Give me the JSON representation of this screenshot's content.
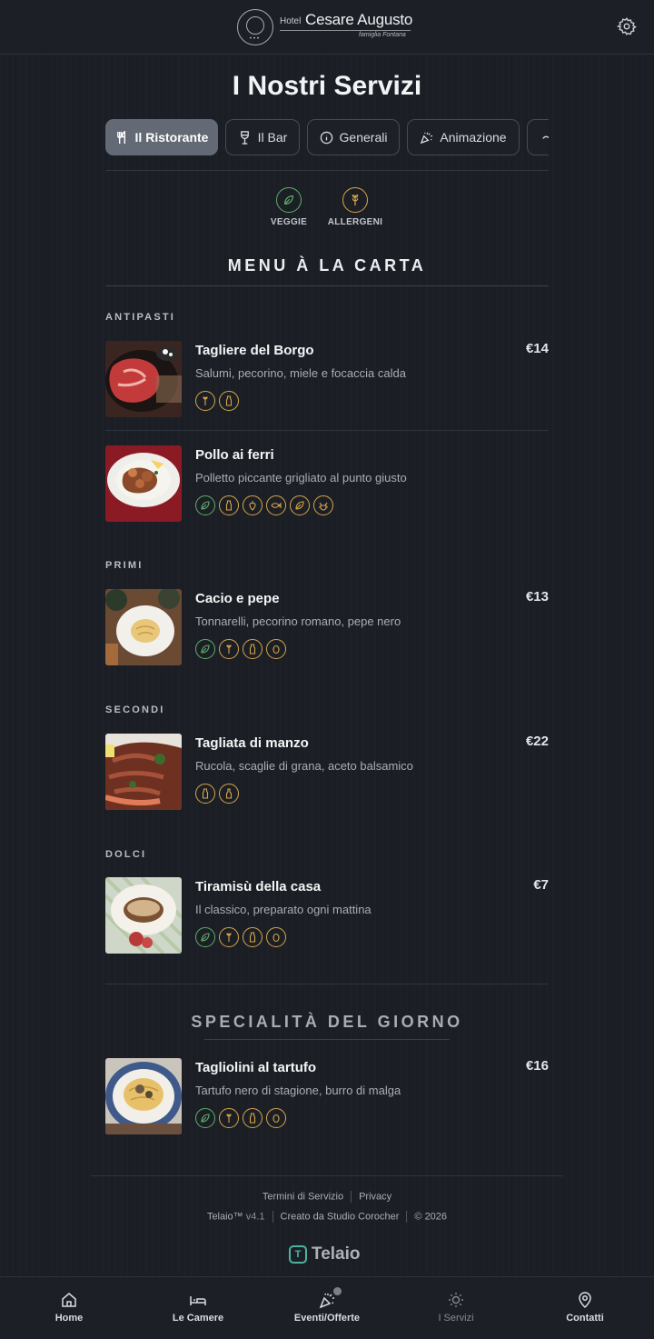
{
  "header": {
    "logo_hotel": "Hotel",
    "logo_name": "Cesare Augusto",
    "logo_family": "famiglia Fontana",
    "logo_stars": "•••"
  },
  "page": {
    "title": "I Nostri Servizi"
  },
  "tabs": [
    {
      "label": "Il Ristorante",
      "icon": "utensils-icon",
      "active": true
    },
    {
      "label": "Il Bar",
      "icon": "wine-glass-icon",
      "active": false
    },
    {
      "label": "Generali",
      "icon": "info-icon",
      "active": false
    },
    {
      "label": "Animazione",
      "icon": "party-icon",
      "active": false
    },
    {
      "label": "",
      "icon": "more-icon",
      "active": false
    }
  ],
  "legend": {
    "veggie": "VEGGIE",
    "allergeni": "ALLERGENI"
  },
  "menu": {
    "title": "MENU À LA CARTA",
    "categories": [
      {
        "name": "ANTIPASTI",
        "items": [
          {
            "name": "Tagliere del Borgo",
            "price": "€14",
            "desc": "Salumi, pecorino, miele e focaccia calda",
            "badges": [
              "gluten-icon",
              "milk-icon"
            ]
          },
          {
            "name": "Pollo ai ferri",
            "price": "",
            "desc": "Polletto piccante grigliato al punto giusto",
            "badges": [
              "leaf-icon",
              "milk-icon",
              "pepper-icon",
              "fish-icon",
              "leaf-icon",
              "crustacean-icon"
            ]
          }
        ]
      },
      {
        "name": "PRIMI",
        "items": [
          {
            "name": "Cacio e pepe",
            "price": "€13",
            "desc": "Tonnarelli, pecorino romano, pepe nero",
            "badges": [
              "leaf-icon",
              "gluten-icon",
              "milk-icon",
              "egg-icon"
            ]
          }
        ]
      },
      {
        "name": "SECONDI",
        "items": [
          {
            "name": "Tagliata di manzo",
            "price": "€22",
            "desc": "Rucola, scaglie di grana, aceto balsamico",
            "badges": [
              "milk-icon",
              "bottle-icon"
            ]
          }
        ]
      },
      {
        "name": "DOLCI",
        "items": [
          {
            "name": "Tiramisù della casa",
            "price": "€7",
            "desc": "Il classico, preparato ogni mattina",
            "badges": [
              "leaf-icon",
              "gluten-icon",
              "milk-icon",
              "egg-icon"
            ]
          }
        ]
      }
    ]
  },
  "special": {
    "title": "SPECIALITÀ DEL GIORNO",
    "items": [
      {
        "name": "Tagliolini al tartufo",
        "price": "€16",
        "desc": "Tartufo nero di stagione, burro di malga",
        "badges": [
          "leaf-icon",
          "gluten-icon",
          "milk-icon",
          "egg-icon"
        ]
      }
    ]
  },
  "footer": {
    "terms": "Termini di Servizio",
    "privacy": "Privacy",
    "product": "Telaio™",
    "version": "v4.1",
    "credits": "Creato da Studio Corocher",
    "copyright": "© 2026",
    "brand": "Telaio",
    "brand_mark": "T"
  },
  "bottom_nav": [
    {
      "label": "Home",
      "icon": "home-icon"
    },
    {
      "label": "Le Camere",
      "icon": "bed-icon"
    },
    {
      "label": "Eventi/Offerte",
      "icon": "party-icon"
    },
    {
      "label": "I Servizi",
      "icon": "sun-icon",
      "current": true
    },
    {
      "label": "Contatti",
      "icon": "map-pin-icon"
    }
  ],
  "colors": {
    "background": "#1b1f25",
    "active_tab": "#636a75",
    "veggie_green": "#5fae6a",
    "allergen_amber": "#d6a64a",
    "brand_teal": "#4db3a0"
  }
}
